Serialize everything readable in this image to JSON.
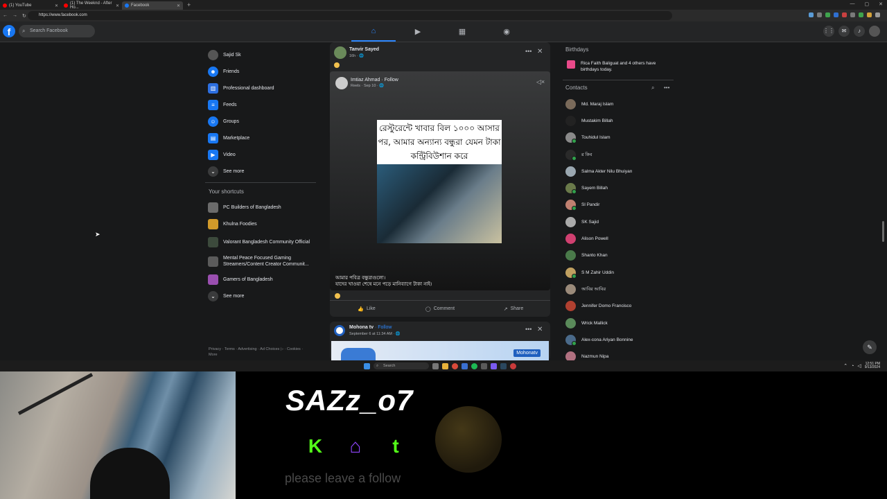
{
  "browser": {
    "tabs": [
      {
        "title": "(1) YouTube",
        "color": "#ff0000",
        "active": false
      },
      {
        "title": "(1) The Weeknd - After Ho...",
        "color": "#ff0000",
        "active": false
      },
      {
        "title": "Facebook",
        "color": "#1877f2",
        "active": true
      }
    ],
    "url": "https://www.facebook.com",
    "window_controls": [
      "—",
      "▢",
      "✕"
    ]
  },
  "facebook": {
    "logo": "f",
    "search_placeholder": "Search Facebook",
    "nav_icons": [
      "home-icon",
      "video-icon",
      "marketplace-icon",
      "groups-icon"
    ],
    "right_icons": [
      "menu-grid-icon",
      "messenger-icon",
      "bell-icon",
      "profile-icon"
    ],
    "accent": "#2d88ff"
  },
  "left_nav": {
    "items": [
      {
        "label": "Sajid Sk",
        "icon": "avatar",
        "color": "#555"
      },
      {
        "label": "Friends",
        "icon": "friends-icon",
        "color": "#1877f2"
      },
      {
        "label": "Professional dashboard",
        "icon": "dashboard-icon",
        "color": "#2d6fe0"
      },
      {
        "label": "Feeds",
        "icon": "feeds-icon",
        "color": "#1877f2"
      },
      {
        "label": "Groups",
        "icon": "groups-icon",
        "color": "#1877f2"
      },
      {
        "label": "Marketplace",
        "icon": "marketplace-icon",
        "color": "#1877f2"
      },
      {
        "label": "Video",
        "icon": "video-icon",
        "color": "#1877f2"
      },
      {
        "label": "See more",
        "icon": "chevron-down-icon",
        "color": "#3a3b3c"
      }
    ],
    "shortcuts_title": "Your shortcuts",
    "shortcuts": [
      {
        "label": "PC Builders of Bangladesh",
        "color": "#6b6b6b"
      },
      {
        "label": "Khulna Foodies",
        "color": "#d19a2a"
      },
      {
        "label": "Valorant Bangladesh Community Official",
        "color": "#3c4a3c"
      },
      {
        "label": "Mental Peace Focused Gaming Streamers/Content Creator Communit...",
        "color": "#5b5b5b"
      },
      {
        "label": "Gamers of Bangladesh",
        "color": "#9a4fb0"
      }
    ],
    "shortcuts_more": "See more",
    "footer": "Privacy · Terms · Advertising · Ad Choices ▷ · Cookies · More"
  },
  "feed": {
    "post1": {
      "author": "Tanvir Sayed",
      "meta": "16h · 🌐",
      "shared_author": "Imtiaz Ahmad · Follow",
      "shared_meta": "Reels · Sep 10 · 🌐",
      "card_text": "রেস্টুরেন্টে খাবার বিল ১০০০ আসার পর, আমার অন্যান্য বন্ধুরা যেমন টাকা কন্ট্রিবিউশান করে",
      "caption_line1": "আমার পবিত্র বন্ধুরাগুলো।",
      "caption_line2": "যাদের খাওয়া শেষে মনে পড়ে মানিব্যাগে টাকা নাই।",
      "like": "Like",
      "comment": "Comment",
      "share": "Share"
    },
    "post2": {
      "author": "Mohona tv",
      "follow": "· Follow",
      "meta": "September 6 at 11:34 AM · 🌐",
      "banner_text": "Mohonatv"
    }
  },
  "right_col": {
    "birthdays_title": "Birthdays",
    "birthday_text": "Rica Faith Baliguat and 4 others have birthdays today.",
    "contacts_title": "Contacts",
    "contacts": [
      {
        "name": "Md. Maraj Islam",
        "color": "#7a6a5a",
        "online": false
      },
      {
        "name": "Mustakim Billah",
        "color": "#222",
        "online": false
      },
      {
        "name": "Touhidul Islam",
        "color": "#8a8a8a",
        "online": true
      },
      {
        "name": "র কিব",
        "color": "#2a2a2a",
        "online": true
      },
      {
        "name": "Salma Akter Nilu Bhuiyan",
        "color": "#9aa7b0",
        "online": false
      },
      {
        "name": "Sayem Billah",
        "color": "#6a7a4a",
        "online": true
      },
      {
        "name": "Sl Pandir",
        "color": "#c08070",
        "online": true
      },
      {
        "name": "SK Sajid",
        "color": "#aaa",
        "online": false
      },
      {
        "name": "Alison Powell",
        "color": "#d04070",
        "online": false
      },
      {
        "name": "Shanto Khan",
        "color": "#4a7a4a",
        "online": false
      },
      {
        "name": "S M Zahir Uddin",
        "color": "#c0a060",
        "online": true
      },
      {
        "name": "আবির আবির",
        "color": "#9a8a7a",
        "online": false
      },
      {
        "name": "Jennifer Domo Francisco",
        "color": "#b04030",
        "online": false
      },
      {
        "name": "Wrick Mallick",
        "color": "#5a8a5a",
        "online": false
      },
      {
        "name": "Alex-cona Ariyan Bonnine",
        "color": "#4a6a8a",
        "online": true
      },
      {
        "name": "Nazmun Nipa",
        "color": "#b07080",
        "online": false
      }
    ]
  },
  "taskbar": {
    "search": "Search",
    "time": "12:51 PM",
    "date": "9/13/2024"
  },
  "stream_overlay": {
    "handle": "SAZz_o7",
    "social_kick": "K",
    "social_twitch": "⌂",
    "social_tiktok": "t",
    "follow_text": "please leave a follow"
  }
}
